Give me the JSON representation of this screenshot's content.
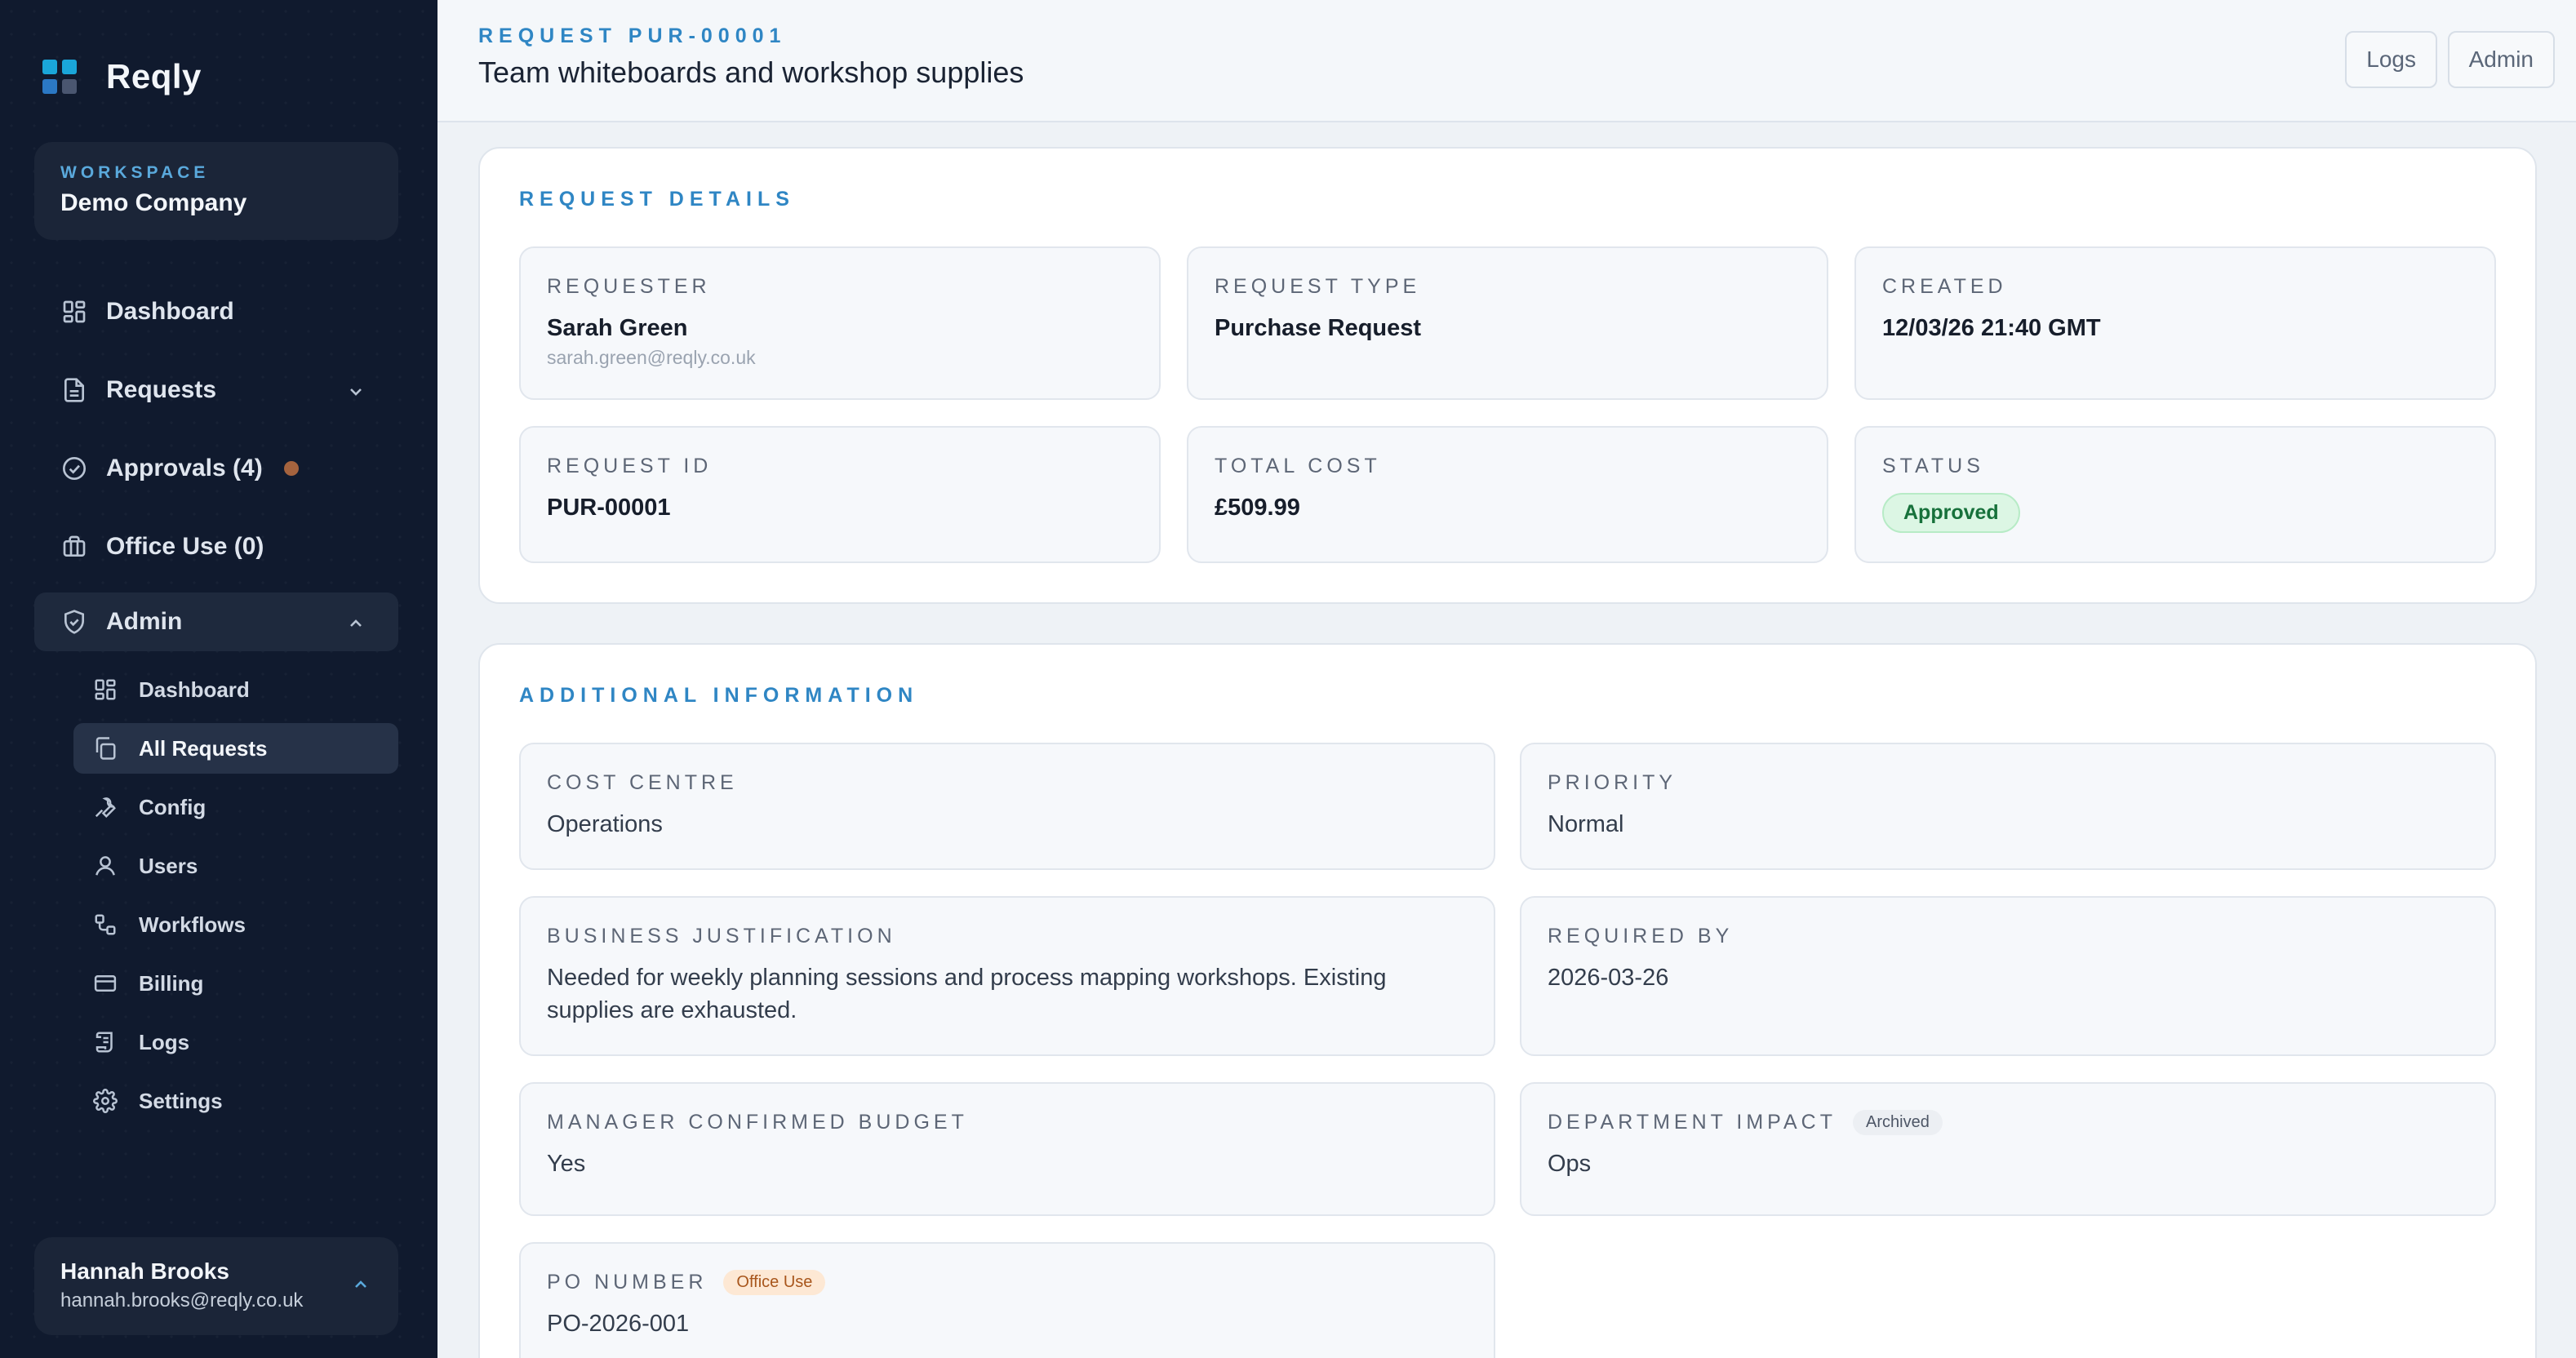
{
  "app": {
    "name": "Reqly"
  },
  "colors": {
    "accent": "#2f86c4",
    "sidebar_bg": "#101a2e",
    "logo_cyan": "#1aa6d9",
    "logo_blue": "#2b78c4",
    "logo_slate": "#4a5670",
    "approvals_dot": "#a5633e",
    "approved_green": "#17713b"
  },
  "workspace": {
    "label": "WORKSPACE",
    "name": "Demo Company"
  },
  "nav": {
    "dashboard": "Dashboard",
    "requests": "Requests",
    "approvals": "Approvals (4)",
    "office_use": "Office Use (0)",
    "admin": "Admin"
  },
  "admin_menu": [
    {
      "label": "Dashboard",
      "icon": "grid-icon"
    },
    {
      "label": "All Requests",
      "icon": "copy-icon"
    },
    {
      "label": "Config",
      "icon": "wrench-icon"
    },
    {
      "label": "Users",
      "icon": "user-icon"
    },
    {
      "label": "Workflows",
      "icon": "workflow-icon"
    },
    {
      "label": "Billing",
      "icon": "credit-card-icon"
    },
    {
      "label": "Logs",
      "icon": "scroll-icon"
    },
    {
      "label": "Settings",
      "icon": "gear-icon"
    }
  ],
  "user": {
    "name": "Hannah Brooks",
    "email": "hannah.brooks@reqly.co.uk"
  },
  "header": {
    "request_id": "REQUEST PUR-00001",
    "title": "Team whiteboards and workshop supplies",
    "logs_button": "Logs",
    "admin_button": "Admin"
  },
  "details": {
    "title": "REQUEST DETAILS",
    "requester_label": "REQUESTER",
    "requester_name": "Sarah Green",
    "requester_email": "sarah.green@reqly.co.uk",
    "type_label": "REQUEST TYPE",
    "type_value": "Purchase Request",
    "created_label": "CREATED",
    "created_value": "12/03/26 21:40 GMT",
    "id_label": "REQUEST ID",
    "id_value": "PUR-00001",
    "cost_label": "TOTAL COST",
    "cost_value": "£509.99",
    "status_label": "STATUS",
    "status_value": "Approved"
  },
  "additional": {
    "title": "ADDITIONAL INFORMATION",
    "cost_centre_label": "COST CENTRE",
    "cost_centre_value": "Operations",
    "priority_label": "PRIORITY",
    "priority_value": "Normal",
    "justification_label": "BUSINESS JUSTIFICATION",
    "justification_value": "Needed for weekly planning sessions and process mapping workshops. Existing supplies are exhausted.",
    "required_by_label": "REQUIRED BY",
    "required_by_value": "2026-03-26",
    "budget_label": "MANAGER CONFIRMED BUDGET",
    "budget_value": "Yes",
    "impact_label": "DEPARTMENT IMPACT",
    "impact_tag": "Archived",
    "impact_value": "Ops",
    "po_label": "PO NUMBER",
    "po_tag": "Office Use",
    "po_value": "PO-2026-001"
  }
}
